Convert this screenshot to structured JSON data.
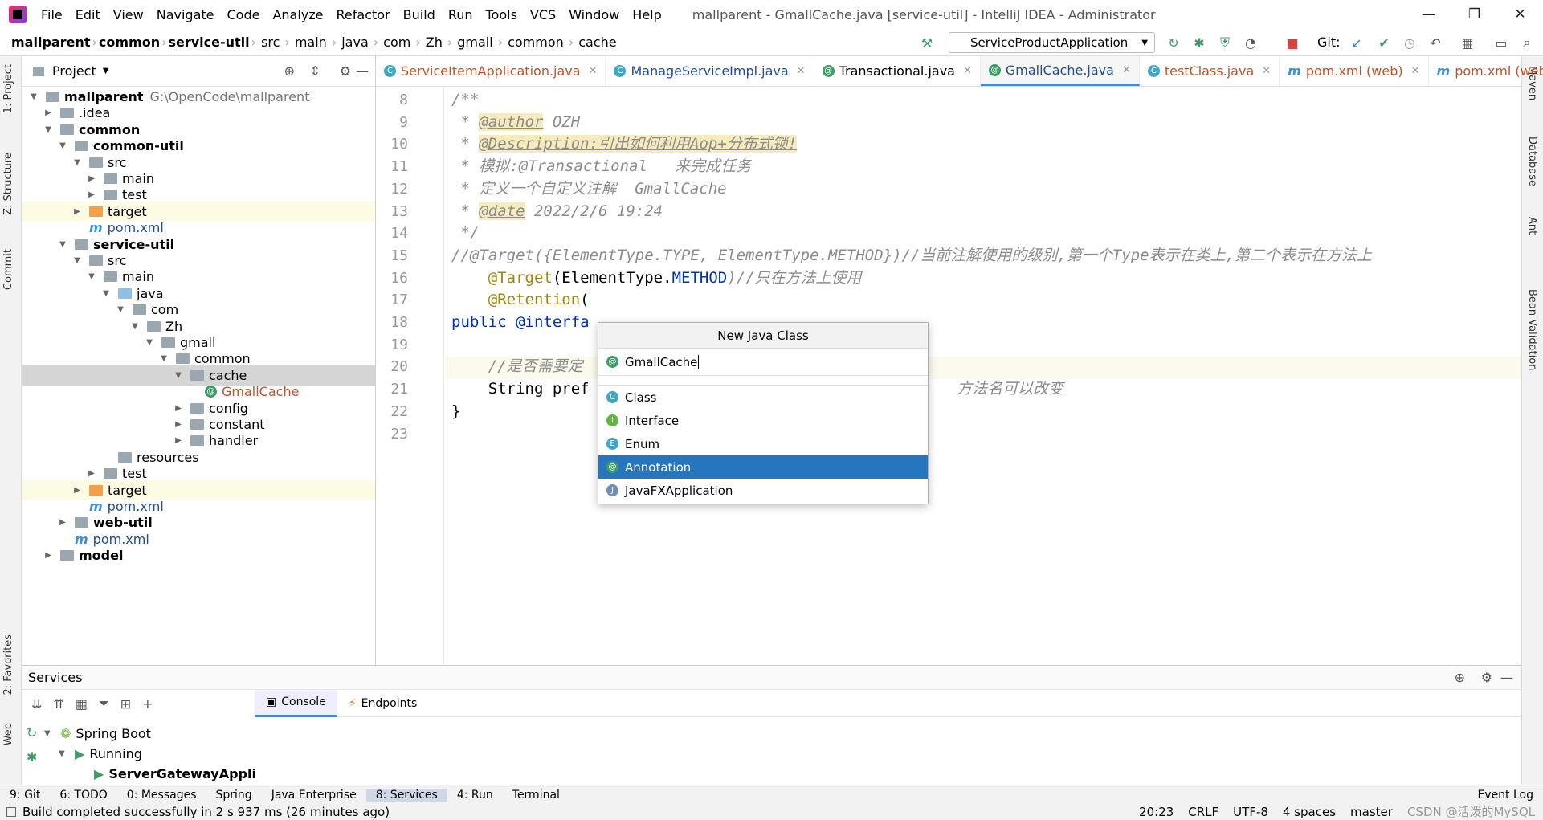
{
  "titlebar": {
    "menu": [
      "File",
      "Edit",
      "View",
      "Navigate",
      "Code",
      "Analyze",
      "Refactor",
      "Build",
      "Run",
      "Tools",
      "VCS",
      "Window",
      "Help"
    ],
    "title": "mallparent - GmallCache.java [service-util] - IntelliJ IDEA - Administrator"
  },
  "breadcrumb": [
    "mallparent",
    "common",
    "service-util",
    "src",
    "main",
    "java",
    "com",
    "Zh",
    "gmall",
    "common",
    "cache"
  ],
  "toolbar": {
    "run_config": "ServiceProductApplication",
    "git_label": "Git:"
  },
  "project": {
    "header": "Project",
    "tree": [
      {
        "label": "mallparent",
        "extra": "G:\\OpenCode\\mallparent",
        "depth": 0,
        "icon": "module",
        "bold": true,
        "arrow": "▼"
      },
      {
        "label": ".idea",
        "depth": 1,
        "icon": "folder",
        "arrow": "▶"
      },
      {
        "label": "common",
        "depth": 1,
        "icon": "module",
        "bold": true,
        "arrow": "▼"
      },
      {
        "label": "common-util",
        "depth": 2,
        "icon": "module",
        "bold": true,
        "arrow": "▼"
      },
      {
        "label": "src",
        "depth": 3,
        "icon": "folder",
        "arrow": "▼"
      },
      {
        "label": "main",
        "depth": 4,
        "icon": "folder",
        "arrow": "▶"
      },
      {
        "label": "test",
        "depth": 4,
        "icon": "folder",
        "arrow": "▶"
      },
      {
        "label": "target",
        "depth": 3,
        "icon": "folder-orange",
        "arrow": "▶",
        "hl": true
      },
      {
        "label": "pom.xml",
        "depth": 3,
        "icon": "maven",
        "arrow": ""
      },
      {
        "label": "service-util",
        "depth": 2,
        "icon": "module",
        "bold": true,
        "arrow": "▼"
      },
      {
        "label": "src",
        "depth": 3,
        "icon": "folder",
        "arrow": "▼"
      },
      {
        "label": "main",
        "depth": 4,
        "icon": "folder",
        "arrow": "▼"
      },
      {
        "label": "java",
        "depth": 5,
        "icon": "folder-blue",
        "arrow": "▼"
      },
      {
        "label": "com",
        "depth": 6,
        "icon": "folder",
        "arrow": "▼"
      },
      {
        "label": "Zh",
        "depth": 7,
        "icon": "folder",
        "arrow": "▼"
      },
      {
        "label": "gmall",
        "depth": 8,
        "icon": "folder",
        "arrow": "▼"
      },
      {
        "label": "common",
        "depth": 9,
        "icon": "folder",
        "arrow": "▼"
      },
      {
        "label": "cache",
        "depth": 10,
        "icon": "folder",
        "arrow": "▼",
        "sel": true
      },
      {
        "label": "GmallCache",
        "depth": 11,
        "icon": "annotation",
        "arrow": "",
        "orange": true
      },
      {
        "label": "config",
        "depth": 10,
        "icon": "folder",
        "arrow": "▶"
      },
      {
        "label": "constant",
        "depth": 10,
        "icon": "folder",
        "arrow": "▶"
      },
      {
        "label": "handler",
        "depth": 10,
        "icon": "folder",
        "arrow": "▶"
      },
      {
        "label": "resources",
        "depth": 5,
        "icon": "folder-res",
        "arrow": ""
      },
      {
        "label": "test",
        "depth": 4,
        "icon": "folder",
        "arrow": "▶"
      },
      {
        "label": "target",
        "depth": 3,
        "icon": "folder-orange",
        "arrow": "▶",
        "hl": true
      },
      {
        "label": "pom.xml",
        "depth": 3,
        "icon": "maven",
        "arrow": ""
      },
      {
        "label": "web-util",
        "depth": 2,
        "icon": "module",
        "bold": true,
        "arrow": "▶"
      },
      {
        "label": "pom.xml",
        "depth": 2,
        "icon": "maven",
        "arrow": ""
      },
      {
        "label": "model",
        "depth": 1,
        "icon": "module",
        "bold": true,
        "arrow": "▶"
      }
    ]
  },
  "tabs": [
    {
      "label": "ServiceItemApplication.java",
      "color": "#c1532a",
      "icon": "#3fa7c7"
    },
    {
      "label": "ManageServiceImpl.java",
      "color": "#1f4d99",
      "icon": "#3fa7c7"
    },
    {
      "label": "Transactional.java",
      "color": "#000000",
      "icon": "#3e9d67"
    },
    {
      "label": "GmallCache.java",
      "color": "#1f4d99",
      "icon": "#3e9d67",
      "active": true
    },
    {
      "label": "testClass.java",
      "color": "#c1532a",
      "icon": "#3fa7c7"
    },
    {
      "label": "pom.xml (web)",
      "color": "#c1532a",
      "icon": "maven"
    },
    {
      "label": "pom.xml (web-all)",
      "color": "#c1532a",
      "icon": "maven"
    }
  ],
  "editor": {
    "line_numbers": [
      "8",
      "9",
      "10",
      "11",
      "12",
      "13",
      "14",
      "15",
      "16",
      "17",
      "18",
      "19",
      "20",
      "21",
      "22",
      "23"
    ],
    "lines": [
      {
        "parts": [
          {
            "t": "/**",
            "c": "cm"
          }
        ]
      },
      {
        "parts": [
          {
            "t": " * ",
            "c": "cm"
          },
          {
            "t": "@author",
            "c": "tag"
          },
          {
            "t": " OZH",
            "c": "cm"
          }
        ]
      },
      {
        "parts": [
          {
            "t": " * ",
            "c": "cm"
          },
          {
            "t": "@Description:引出如何利用Aop+分布式锁!",
            "c": "tag"
          }
        ]
      },
      {
        "parts": [
          {
            "t": " * 模拟:@Transactional   来完成任务",
            "c": "cm"
          }
        ]
      },
      {
        "parts": [
          {
            "t": " * 定义一个自定义注解  GmallCache",
            "c": "cm"
          }
        ]
      },
      {
        "parts": [
          {
            "t": " * ",
            "c": "cm"
          },
          {
            "t": "@date",
            "c": "tag"
          },
          {
            "t": " 2022/2/6 19:24",
            "c": "cm"
          }
        ]
      },
      {
        "parts": [
          {
            "t": " */",
            "c": "cm"
          }
        ]
      },
      {
        "parts": [
          {
            "t": "//@Target({ElementType.TYPE, ElementType.METHOD})//当前注解使用的级别,第一个Type表示在类上,第二个表示在方法上",
            "c": "cm"
          }
        ]
      },
      {
        "parts": [
          {
            "t": "    ",
            "c": "pl"
          },
          {
            "t": "@Target",
            "c": "ann"
          },
          {
            "t": "(ElementType.",
            "c": "pl"
          },
          {
            "t": "METHOD",
            "c": "kw"
          },
          {
            "t": ")//只在方法上使用",
            "c": "cm"
          }
        ]
      },
      {
        "parts": [
          {
            "t": "    ",
            "c": "pl"
          },
          {
            "t": "@Retention",
            "c": "ann"
          },
          {
            "t": "(",
            "c": "pl"
          }
        ]
      },
      {
        "parts": [
          {
            "t": "public ",
            "c": "kw"
          },
          {
            "t": "@interfa",
            "c": "kw"
          }
        ]
      },
      {
        "parts": [
          {
            "t": "",
            "c": "pl"
          }
        ]
      },
      {
        "parts": [
          {
            "t": "    //是否需要定",
            "c": "cm"
          }
        ]
      },
      {
        "parts": [
          {
            "t": "    String pref",
            "c": "pl"
          },
          {
            "t": "                                        方法名可以改变",
            "c": "cm"
          }
        ]
      },
      {
        "parts": [
          {
            "t": "}",
            "c": "pl"
          }
        ]
      },
      {
        "parts": [
          {
            "t": "",
            "c": "pl"
          }
        ]
      }
    ]
  },
  "popup": {
    "title": "New Java Class",
    "input_value": "GmallCache",
    "options": [
      {
        "label": "Class",
        "letter": "C",
        "color": "#3fa7c7"
      },
      {
        "label": "Interface",
        "letter": "I",
        "color": "#62b543"
      },
      {
        "label": "Enum",
        "letter": "E",
        "color": "#3fa7c7"
      },
      {
        "label": "Annotation",
        "letter": "@",
        "color": "#3e9d67",
        "sel": true
      },
      {
        "label": "JavaFXApplication",
        "letter": "J",
        "color": "#6f8fb3"
      }
    ]
  },
  "services": {
    "title": "Services",
    "tabs": [
      "Console",
      "Endpoints"
    ],
    "tree": [
      "Spring Boot",
      "Running",
      "ServerGatewayAppli"
    ]
  },
  "bottom_tools": [
    "9: Git",
    "6: TODO",
    "0: Messages",
    "Spring",
    "Java Enterprise",
    "8: Services",
    "4: Run",
    "Terminal"
  ],
  "event_log": "Event Log",
  "status": {
    "message": "Build completed successfully in 2 s 937 ms (26 minutes ago)",
    "position": "20:23",
    "line_sep": "CRLF",
    "encoding": "UTF-8",
    "indent": "4 spaces",
    "branch": "master",
    "watermark": "CSDN @活泼的MySQL"
  },
  "side_labels": {
    "left": [
      "1: Project",
      "Z: Structure",
      "Commit",
      "2: Favorites",
      "Web"
    ],
    "right": [
      "Maven",
      "Database",
      "Ant",
      "Bean Validation"
    ]
  }
}
